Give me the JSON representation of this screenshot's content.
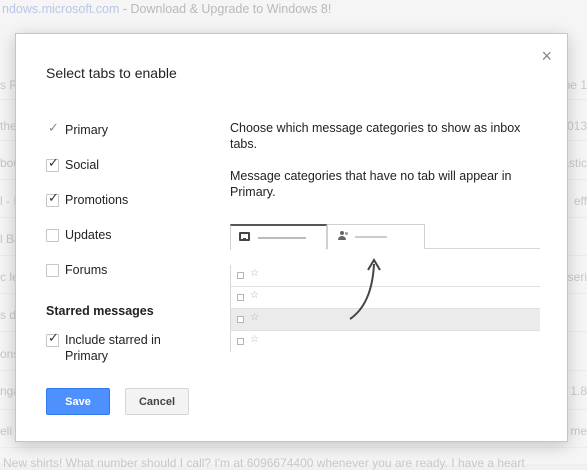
{
  "background": {
    "top_line_url": "ndows.microsoft.com",
    "top_line_text": " - Download & Upgrade to Windows 8!",
    "rows": [
      {
        "left": "s Re",
        "right": "me 1"
      },
      {
        "left": "the",
        "right": "013"
      },
      {
        "left": "bou",
        "right": "astic"
      },
      {
        "left": "l - I",
        "right": "eff"
      },
      {
        "left": "l Ba",
        "right": ""
      },
      {
        "left": "c le",
        "right": "seri"
      },
      {
        "left": "s dis",
        "right": ""
      },
      {
        "left": "ons",
        "right": ""
      },
      {
        "left": "nga",
        "right": "1.8"
      },
      {
        "left": "eli",
        "right": "me"
      }
    ],
    "bottom_line": "New shirts! What number should I call? I'm at 6096674400 whenever you are ready. I have a heart"
  },
  "dialog": {
    "title": "Select tabs to enable",
    "close_glyph": "×",
    "tabs": [
      {
        "label": "Primary",
        "checked": true,
        "disabled": true
      },
      {
        "label": "Social",
        "checked": true
      },
      {
        "label": "Promotions",
        "checked": true
      },
      {
        "label": "Updates",
        "checked": false
      },
      {
        "label": "Forums",
        "checked": false
      }
    ],
    "starred_heading": "Starred messages",
    "starred_option": {
      "label": "Include starred in Primary",
      "checked": true
    },
    "description_1": "Choose which message categories to show as inbox tabs.",
    "description_2": "Message categories that have no tab will appear in Primary.",
    "save_label": "Save",
    "cancel_label": "Cancel",
    "tick_glyph": "✓",
    "star_glyph": "☆"
  },
  "colors": {
    "save_button": "#4d90fe",
    "save_border": "#3079ed"
  }
}
